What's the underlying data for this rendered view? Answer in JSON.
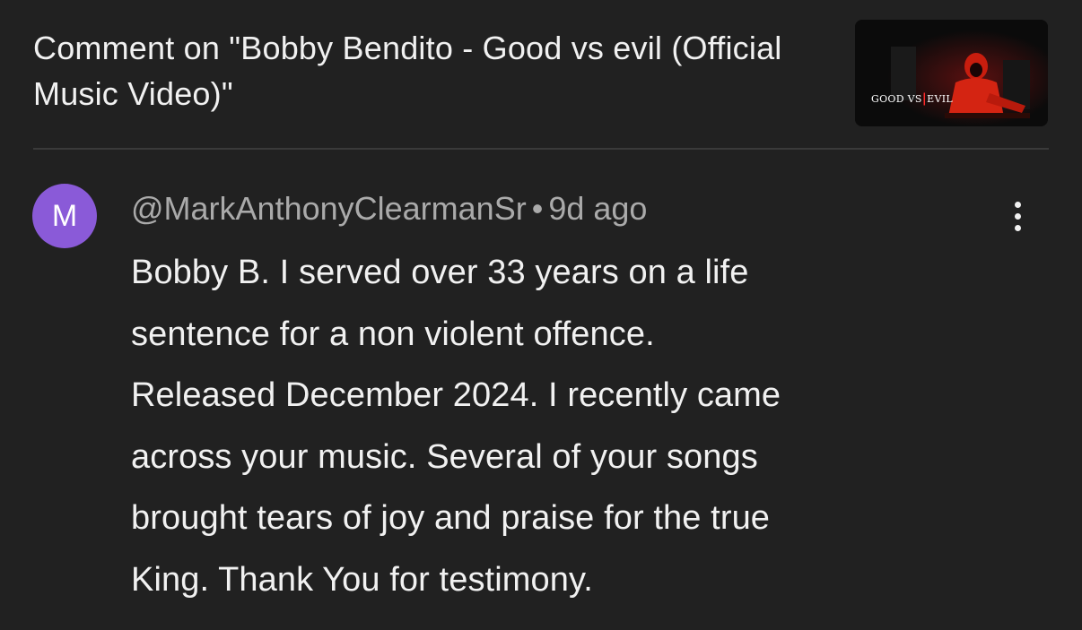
{
  "header": {
    "title": "Comment on \"Bobby Bendito - Good vs evil (Official Music Video)\"",
    "thumbnail_text_left": "GOOD VS",
    "thumbnail_text_slash": "|",
    "thumbnail_text_right": "EVIL"
  },
  "comment": {
    "avatar_letter": "M",
    "author": "@MarkAnthonyClearmanSr",
    "separator": "•",
    "time": "9d ago",
    "text": "Bobby B.  I served  over 33 years on a life\nsentence for a non violent offence.\nReleased December 2024. I recently came\nacross your music. Several of your songs\nbrought tears of joy and  praise for the true\nKing. Thank You for testimony.",
    "menu_icon": "more-vertical-icon"
  },
  "colors": {
    "background": "#212121",
    "avatar": "#8a5ad8",
    "meta_text": "#aaaaaa",
    "primary_text": "#f1f1f1"
  }
}
